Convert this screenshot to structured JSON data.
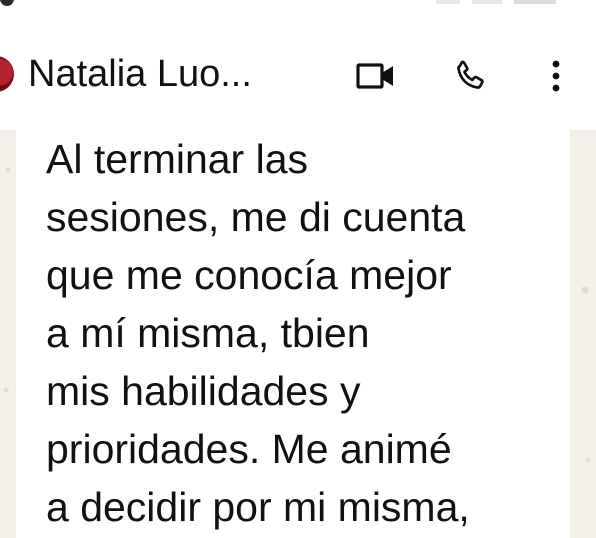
{
  "header": {
    "contact_name": "Natalia Luo...",
    "video_call_icon": "video-camera-icon",
    "voice_call_icon": "phone-icon",
    "menu_icon": "more-vertical-icon"
  },
  "message": {
    "lines": [
      "Al terminar las",
      "sesiones, me di cuenta",
      "que me conocía mejor",
      "a mí misma, tbien",
      "mis habilidades y",
      "prioridades. Me animé",
      "a decidir por mi misma,"
    ]
  },
  "colors": {
    "chat_background": "#f3efe9",
    "bubble": "#ffffff",
    "text": "#111111",
    "avatar": "#b5212f"
  }
}
